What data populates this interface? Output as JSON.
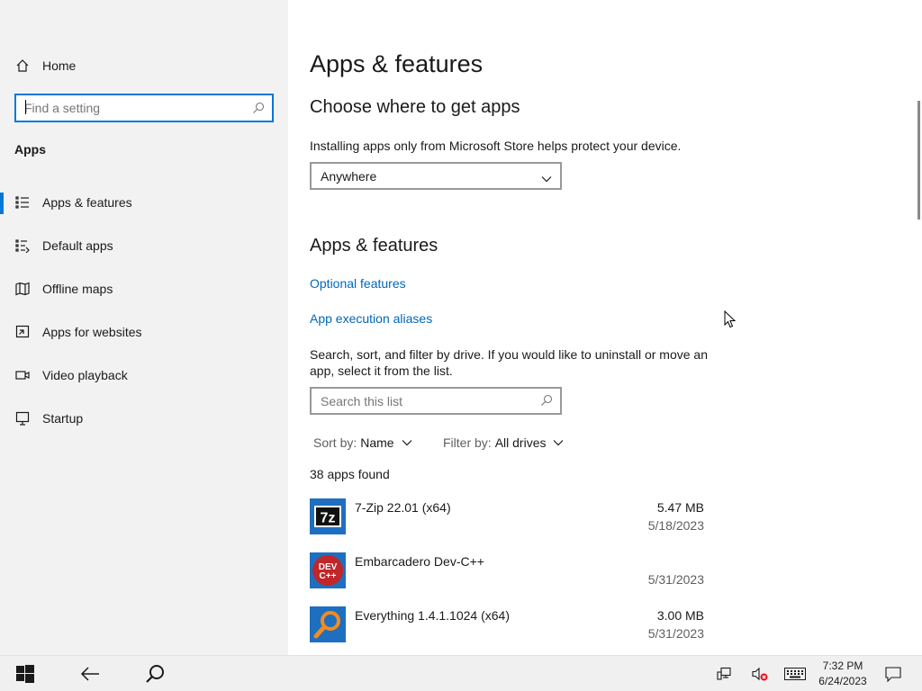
{
  "sidebar": {
    "home_label": "Home",
    "search_placeholder": "Find a setting",
    "section_label": "Apps",
    "items": [
      {
        "label": "Apps & features",
        "icon": "list-icon",
        "active": true
      },
      {
        "label": "Default apps",
        "icon": "default-apps-icon"
      },
      {
        "label": "Offline maps",
        "icon": "map-icon"
      },
      {
        "label": "Apps for websites",
        "icon": "apps-websites-icon"
      },
      {
        "label": "Video playback",
        "icon": "video-icon"
      },
      {
        "label": "Startup",
        "icon": "startup-icon"
      }
    ]
  },
  "main": {
    "title": "Apps & features",
    "choose": {
      "heading": "Choose where to get apps",
      "description": "Installing apps only from Microsoft Store helps protect your device.",
      "selected": "Anywhere"
    },
    "features": {
      "heading": "Apps & features",
      "link_optional": "Optional features",
      "link_aliases": "App execution aliases",
      "description": "Search, sort, and filter by drive. If you would like to uninstall or move an app, select it from the list.",
      "search_placeholder": "Search this list",
      "sort_key": "Sort by:",
      "sort_value": "Name",
      "filter_key": "Filter by:",
      "filter_value": "All drives",
      "count": "38 apps found"
    },
    "apps": [
      {
        "name": "7-Zip 22.01 (x64)",
        "size": "5.47 MB",
        "date": "5/18/2023",
        "icon": "7zip-icon"
      },
      {
        "name": "Embarcadero Dev-C++",
        "size": "",
        "date": "5/31/2023",
        "icon": "devcpp-icon"
      },
      {
        "name": "Everything 1.4.1.1024 (x64)",
        "size": "3.00 MB",
        "date": "5/31/2023",
        "icon": "everything-icon"
      }
    ]
  },
  "taskbar": {
    "time": "7:32 PM",
    "date": "6/24/2023"
  },
  "colors": {
    "accent": "#0078d7",
    "link": "#0067b8",
    "sidebar_bg": "#f2f2f2"
  }
}
